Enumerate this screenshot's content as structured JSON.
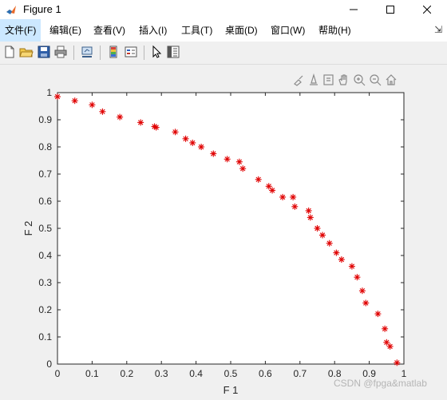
{
  "window": {
    "title": "Figure 1"
  },
  "menu": [
    {
      "label": "文件(F)",
      "active": true
    },
    {
      "label": "编辑(E)"
    },
    {
      "label": "查看(V)"
    },
    {
      "label": "插入(I)"
    },
    {
      "label": "工具(T)"
    },
    {
      "label": "桌面(D)"
    },
    {
      "label": "窗口(W)"
    },
    {
      "label": "帮助(H)"
    }
  ],
  "toolbar_icons": [
    "new-figure-icon",
    "open-file-icon",
    "save-icon",
    "print-icon",
    "link-plot-icon",
    "insert-colorbar-icon",
    "insert-legend-icon",
    "edit-plot-cursor-icon",
    "property-inspector-icon"
  ],
  "axes_toolbar_icons": [
    "brush-icon",
    "data-tips-icon",
    "export-icon",
    "pan-icon",
    "zoom-in-icon",
    "zoom-out-icon",
    "home-icon"
  ],
  "colors": {
    "marker": "#e00000",
    "axes_bg": "#ffffff",
    "figure_bg": "#f0f0f0"
  },
  "watermark": "CSDN @fpga&matlab",
  "chart_data": {
    "type": "scatter",
    "marker": "*",
    "xlabel": "F 1",
    "ylabel": "F 2",
    "xlim": [
      0,
      1
    ],
    "ylim": [
      0,
      1
    ],
    "xticks": [
      "0",
      "0.1",
      "0.2",
      "0.3",
      "0.4",
      "0.5",
      "0.6",
      "0.7",
      "0.8",
      "0.9",
      "1"
    ],
    "yticks": [
      "0",
      "0.1",
      "0.2",
      "0.3",
      "0.4",
      "0.5",
      "0.6",
      "0.7",
      "0.8",
      "0.9",
      "1"
    ],
    "grid": false,
    "x": [
      0.0,
      0.05,
      0.1,
      0.13,
      0.18,
      0.24,
      0.28,
      0.285,
      0.34,
      0.37,
      0.39,
      0.415,
      0.45,
      0.49,
      0.525,
      0.535,
      0.58,
      0.61,
      0.62,
      0.65,
      0.68,
      0.685,
      0.725,
      0.73,
      0.75,
      0.765,
      0.785,
      0.805,
      0.82,
      0.85,
      0.865,
      0.88,
      0.89,
      0.925,
      0.945,
      0.95,
      0.96,
      0.98
    ],
    "y": [
      0.985,
      0.97,
      0.955,
      0.93,
      0.91,
      0.89,
      0.875,
      0.872,
      0.855,
      0.83,
      0.815,
      0.8,
      0.775,
      0.755,
      0.745,
      0.72,
      0.68,
      0.655,
      0.64,
      0.615,
      0.615,
      0.58,
      0.565,
      0.54,
      0.5,
      0.475,
      0.445,
      0.41,
      0.385,
      0.36,
      0.32,
      0.27,
      0.225,
      0.185,
      0.13,
      0.08,
      0.065,
      0.005
    ]
  }
}
